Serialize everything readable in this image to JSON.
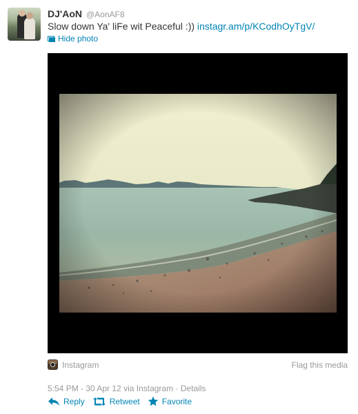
{
  "tweet": {
    "display_name": "DJ'AoN",
    "handle": "@AonAF8",
    "text": "Slow down Ya' liFe wit Peaceful :))",
    "link": "instagr.am/p/KCodhOyTgV/",
    "hide_photo_label": "Hide photo",
    "source_name": "Instagram",
    "flag_label": "Flag this media",
    "meta": "5:54 PM - 30 Apr 12 via Instagram · Details",
    "actions": {
      "reply": "Reply",
      "retweet": "Retweet",
      "favorite": "Favorite"
    }
  },
  "colors": {
    "link": "#0084b4",
    "muted": "#999999",
    "text": "#333333",
    "media_background": "#000000"
  },
  "icons": [
    "photo-icon",
    "instagram-icon",
    "reply-icon",
    "retweet-icon",
    "favorite-icon"
  ]
}
